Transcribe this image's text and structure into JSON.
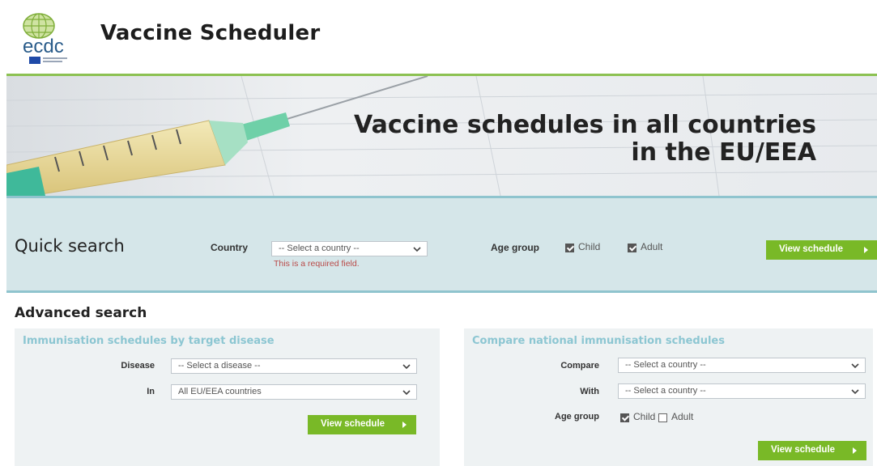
{
  "header": {
    "logo_text": "ecdc",
    "app_title": "Vaccine Scheduler"
  },
  "banner": {
    "title_line1": "Vaccine schedules in all countries",
    "title_line2": "in the EU/EEA"
  },
  "quick_search": {
    "title": "Quick search",
    "country_label": "Country",
    "country_select": "-- Select a country --",
    "error": "This is a required field.",
    "age_group_label": "Age group",
    "child_label": "Child",
    "child_checked": true,
    "adult_label": "Adult",
    "adult_checked": true,
    "button": "View schedule"
  },
  "advanced_search": {
    "title": "Advanced search",
    "by_disease": {
      "title": "Immunisation schedules by target disease",
      "disease_label": "Disease",
      "disease_select": "-- Select a disease --",
      "in_label": "In",
      "in_select": "All EU/EEA countries",
      "button": "View schedule"
    },
    "compare": {
      "title": "Compare national immunisation schedules",
      "compare_label": "Compare",
      "compare_select": "-- Select a country --",
      "with_label": "With",
      "with_select": "-- Select a country --",
      "age_group_label": "Age group",
      "child_label": "Child",
      "child_checked": true,
      "adult_label": "Adult",
      "adult_checked": false,
      "button": "View schedule"
    }
  },
  "colors": {
    "accent_green": "#79b927",
    "panel_title_blue": "#8cc6d2",
    "quick_bg": "#d5e6e9",
    "error_red": "#b94a48"
  }
}
